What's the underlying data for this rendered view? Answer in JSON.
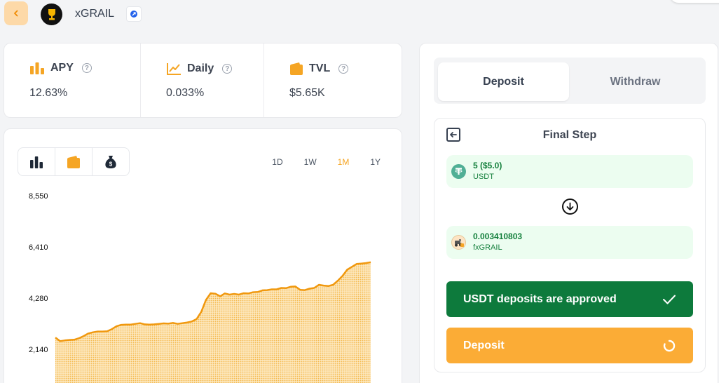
{
  "header": {
    "title": "xGRAIL"
  },
  "stats": [
    {
      "label": "APY",
      "value": "12.63%",
      "icon": "bar-chart-icon"
    },
    {
      "label": "Daily",
      "value": "0.033%",
      "icon": "trend-up-icon"
    },
    {
      "label": "TVL",
      "value": "$5.65K",
      "icon": "wallet-icon"
    }
  ],
  "chart_card": {
    "view_toggle": [
      "bar-chart-icon",
      "wallet-icon",
      "money-bag-icon"
    ],
    "active_view": 1,
    "ranges": [
      "1D",
      "1W",
      "1M",
      "1Y"
    ],
    "active_range": "1M"
  },
  "chart_data": {
    "type": "area",
    "y_ticks": [
      "8,550",
      "6,410",
      "4,280",
      "2,140"
    ],
    "ylim": [
      0,
      8550
    ],
    "xlabel": "",
    "ylabel": "",
    "values": [
      2630,
      2480,
      2510,
      2530,
      2540,
      2600,
      2690,
      2800,
      2850,
      2880,
      2880,
      2890,
      2980,
      3100,
      3160,
      3170,
      3170,
      3200,
      3230,
      3180,
      3170,
      3180,
      3200,
      3220,
      3210,
      3240,
      3200,
      3230,
      3260,
      3300,
      3400,
      3700,
      4200,
      4480,
      4460,
      4350,
      4470,
      4420,
      4450,
      4420,
      4480,
      4470,
      4520,
      4530,
      4600,
      4610,
      4640,
      4640,
      4700,
      4690,
      4750,
      4760,
      4620,
      4610,
      4670,
      4700,
      4830,
      4800,
      4780,
      4830,
      5000,
      5200,
      5460,
      5580,
      5700,
      5720,
      5740,
      5770
    ],
    "color": "#f0980e",
    "fill": "#f7c66a"
  },
  "panel": {
    "tabs": [
      "Deposit",
      "Withdraw"
    ],
    "active_tab": "Deposit",
    "step_title": "Final Step",
    "from": {
      "amount": "5 ($5.0)",
      "token": "USDT",
      "icon": "tether-icon"
    },
    "to": {
      "amount": "0.003410803",
      "token": "fxGRAIL",
      "icon": "fxgrail-token-icon"
    },
    "approved_label": "USDT deposits are approved",
    "deposit_label": "Deposit"
  },
  "colors": {
    "accent": "#f5a524",
    "success": "#0d7a3c",
    "success_bg": "#ecfdf0",
    "deposit_button": "#fbac36"
  }
}
